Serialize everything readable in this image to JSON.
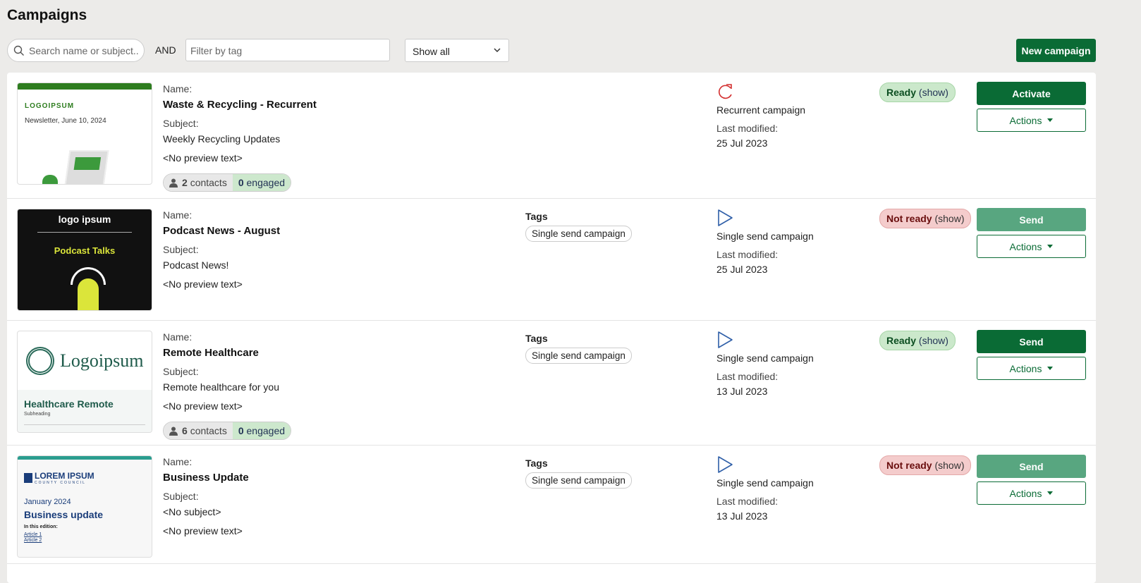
{
  "page": {
    "title": "Campaigns"
  },
  "toolbar": {
    "search_placeholder": "Search name or subject..",
    "and_label": "AND",
    "tag_placeholder": "Filter by tag",
    "filter_value": "Show all",
    "new_campaign": "New campaign"
  },
  "labels": {
    "name": "Name:",
    "subject": "Subject:",
    "tags": "Tags",
    "last_modified": "Last modified:",
    "actions": "Actions",
    "show": "(show)"
  },
  "colors": {
    "primary": "#0a6b35",
    "primary_disabled": "#58a680",
    "ready_bg": "#cbe8cb",
    "not_ready_bg": "#f4cccc",
    "recurrent_icon": "#d32f2f",
    "single_icon": "#2f5fa8"
  },
  "campaigns": [
    {
      "thumb": {
        "style": "recycling",
        "logo": "LOGOIPSUM",
        "line1": "Newsletter, June 10, 2024"
      },
      "name": "Waste & Recycling - Recurrent",
      "subject": "Weekly Recycling Updates",
      "preview": "<No preview text>",
      "contacts": "2",
      "contacts_label": "contacts",
      "engaged": "0",
      "engaged_label": "engaged",
      "tag": null,
      "type_icon": "recurrent-icon",
      "type": "Recurrent campaign",
      "modified": "25 Jul 2023",
      "status": "Ready",
      "ready": true,
      "primary": "Activate",
      "primary_enabled": true
    },
    {
      "thumb": {
        "style": "podcast",
        "logo": "logo ipsum",
        "line1": "Podcast Talks"
      },
      "name": "Podcast News - August",
      "subject": "Podcast News!",
      "preview": "<No preview text>",
      "contacts": null,
      "tag": "Single send campaign",
      "type_icon": "play-icon",
      "type": "Single send campaign",
      "modified": "25 Jul 2023",
      "status": "Not ready",
      "ready": false,
      "primary": "Send",
      "primary_enabled": false
    },
    {
      "thumb": {
        "style": "health",
        "logo": "Logoipsum",
        "line1": "Healthcare Remote",
        "line2": "Subheading"
      },
      "name": "Remote Healthcare",
      "subject": "Remote healthcare for you",
      "preview": "<No preview text>",
      "contacts": "6",
      "contacts_label": "contacts",
      "engaged": "0",
      "engaged_label": "engaged",
      "tag": "Single send campaign",
      "type_icon": "play-icon",
      "type": "Single send campaign",
      "modified": "13 Jul 2023",
      "status": "Ready",
      "ready": true,
      "primary": "Send",
      "primary_enabled": true
    },
    {
      "thumb": {
        "style": "council",
        "logo": "LOREM IPSUM",
        "logo_sub": "COUNTY COUNCIL",
        "line1": "January 2024",
        "line2": "Business update",
        "line3": "In this edition:",
        "links": [
          "Article 1",
          "Article 2"
        ]
      },
      "name": "Business Update",
      "subject": "<No subject>",
      "preview": "<No preview text>",
      "contacts": null,
      "tag": "Single send campaign",
      "type_icon": "play-icon",
      "type": "Single send campaign",
      "modified": "13 Jul 2023",
      "status": "Not ready",
      "ready": false,
      "primary": "Send",
      "primary_enabled": false
    }
  ]
}
